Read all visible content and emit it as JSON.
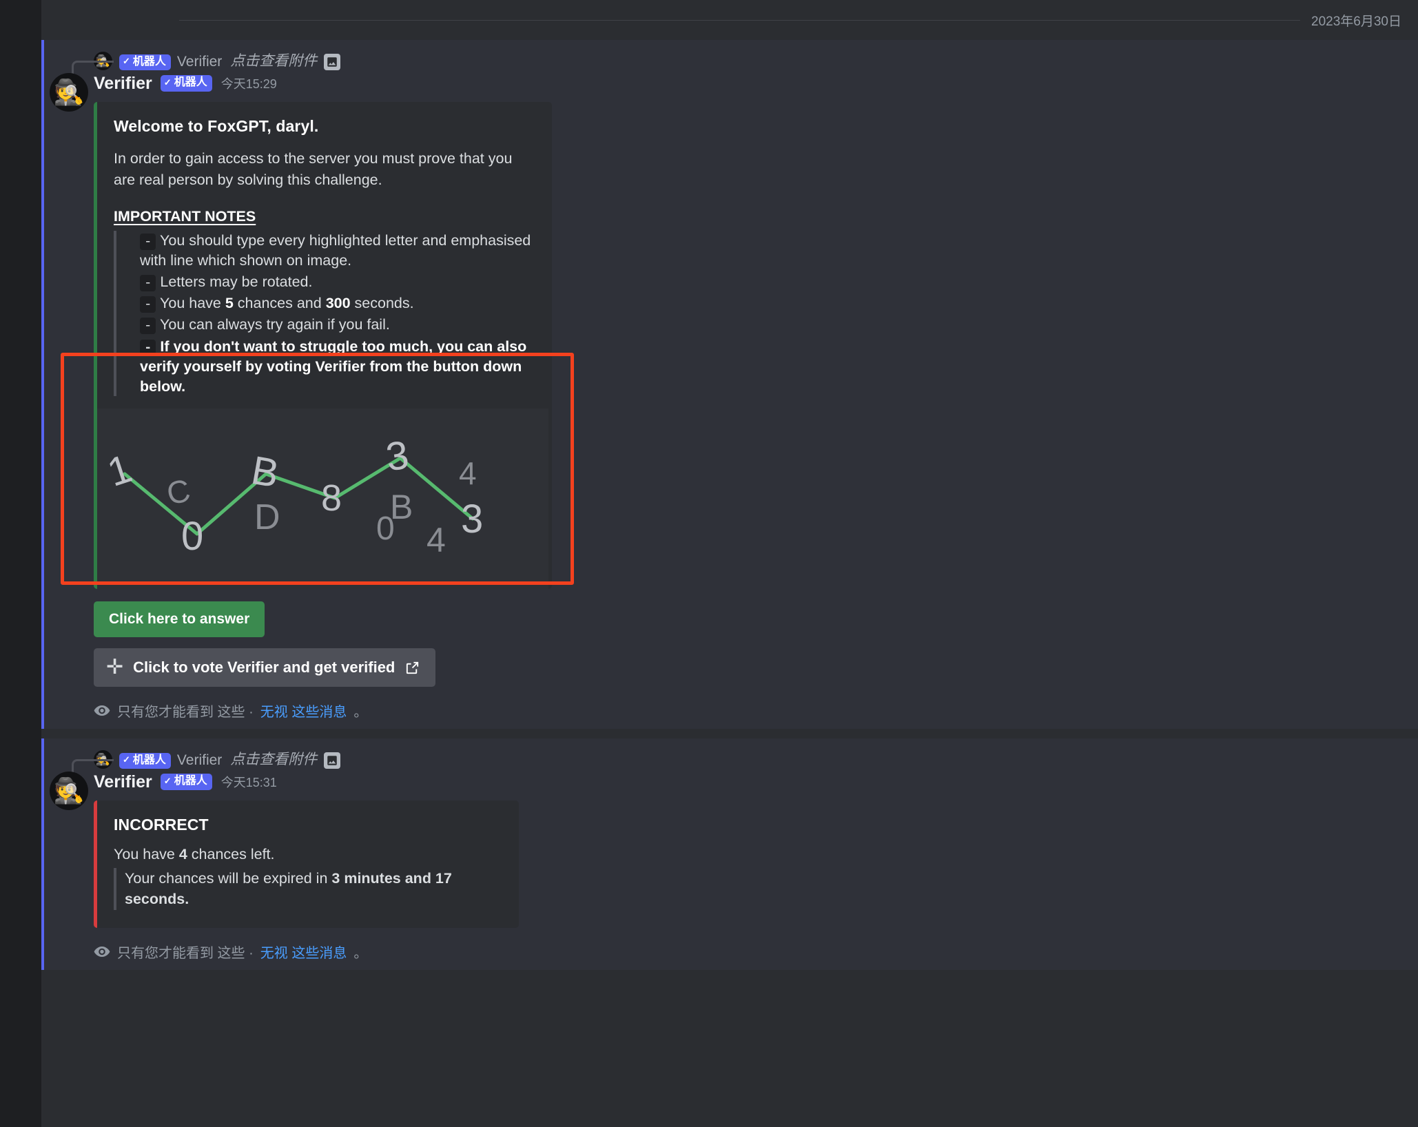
{
  "date_divider": {
    "label": "2023年6月30日"
  },
  "messages": [
    {
      "reply_preview": {
        "bot_tag": "机器人",
        "bot_tag_check": "✓",
        "author": "Verifier",
        "text": "点击查看附件",
        "attachment_icon": "image-icon"
      },
      "author": "Verifier",
      "bot_tag": "机器人",
      "bot_tag_check": "✓",
      "timestamp": "今天15:29",
      "avatar_icon": "detective-avatar",
      "embed": {
        "accent_color": "#2f7d46",
        "title_plain_a": "Welcome to ",
        "title_bold": "FoxGPT",
        "title_plain_b": ", daryl.",
        "description": "In order to gain access to the server you must prove that you are real person by solving this challenge.",
        "notes_heading": "IMPORTANT NOTES",
        "notes": [
          {
            "bullet": "-",
            "text": "You should type every highlighted letter and emphasised with line which shown on image.",
            "bold": false
          },
          {
            "bullet": "-",
            "text": "Letters may be rotated.",
            "bold": false
          },
          {
            "bullet": "-",
            "text": "You have 5 chances and 300 seconds.",
            "bold": false,
            "bold_parts": [
              "5",
              "300"
            ]
          },
          {
            "bullet": "-",
            "text": "You can always try again if you fail.",
            "bold": false
          },
          {
            "bullet": "-",
            "text": "If you don't want to struggle too much, you can also verify yourself by voting Verifier from the button down below.",
            "bold": true
          }
        ]
      },
      "captcha": {
        "background": "#2f3136",
        "line_color": "#57ba6f",
        "char_color": "#a3a7ad",
        "answer_chars": [
          "1",
          "0",
          "B",
          "8",
          "3",
          "3"
        ],
        "decoy_chars": [
          "C",
          "D",
          "B",
          "0",
          "4",
          "4"
        ]
      },
      "answer_button": "Click here to answer",
      "vote_button": {
        "label": "Click to vote Verifier and get verified",
        "plus_icon": "plus-icon",
        "external_icon": "external-link-icon"
      },
      "ephemeral": {
        "eye_icon": "eye-icon",
        "text_a": "只有您才能看到 这些 · ",
        "link": "无视 这些消息",
        "text_b": "。"
      }
    },
    {
      "reply_preview": {
        "bot_tag": "机器人",
        "bot_tag_check": "✓",
        "author": "Verifier",
        "text": "点击查看附件",
        "attachment_icon": "image-icon"
      },
      "author": "Verifier",
      "bot_tag": "机器人",
      "bot_tag_check": "✓",
      "timestamp": "今天15:31",
      "avatar_icon": "detective-avatar",
      "embed": {
        "accent_color": "#d83c3e",
        "title": "INCORRECT",
        "line_1_a": "You have ",
        "line_1_bold": "4",
        "line_1_b": " chances left.",
        "line_2_a": "Your chances will be expired in ",
        "line_2_bold": "3 minutes and 17 seconds."
      },
      "ephemeral": {
        "eye_icon": "eye-icon",
        "text_a": "只有您才能看到 这些 · ",
        "link": "无视 这些消息",
        "text_b": "。"
      }
    }
  ],
  "annotation": {
    "highlight_color": "#f4411e"
  },
  "chart_data": {
    "type": "line",
    "title": "",
    "xlabel": "",
    "ylabel": "",
    "grid": false,
    "legend": "none",
    "note": "CAPTCHA line-graph: characters sit on each vertex of the polyline; decoy characters float off-line.",
    "x": [
      1,
      2,
      3,
      4,
      5,
      6
    ],
    "values": [
      78,
      18,
      72,
      55,
      88,
      40
    ],
    "point_labels": [
      "1",
      "0",
      "B",
      "8",
      "3",
      "3"
    ],
    "decoys": [
      {
        "char": "C",
        "x": 1.35,
        "y": 46
      },
      {
        "char": "D",
        "x": 2.95,
        "y": 34
      },
      {
        "char": "B",
        "x": 4.85,
        "y": 52
      },
      {
        "char": "0",
        "x": 4.75,
        "y": 34
      },
      {
        "char": "4",
        "x": 5.75,
        "y": 76
      },
      {
        "char": "4",
        "x": 5.45,
        "y": 13
      }
    ],
    "line_color": "#57ba6f",
    "bg_color": "#2f3136"
  }
}
